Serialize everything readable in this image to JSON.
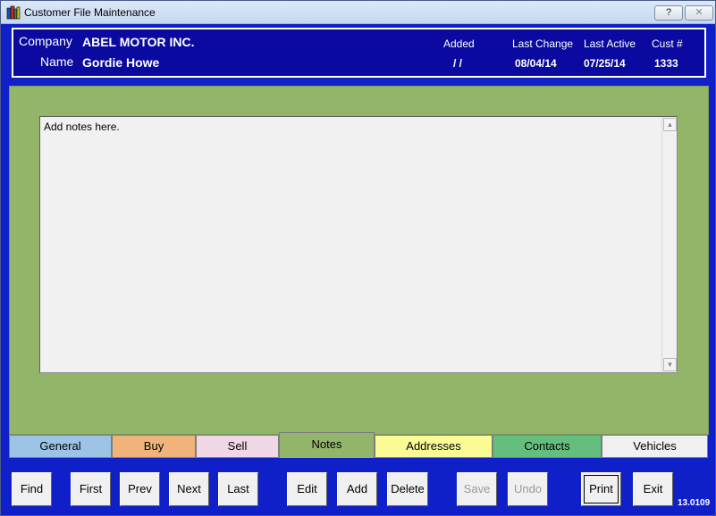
{
  "window": {
    "title": "Customer File Maintenance",
    "help_label": "?",
    "close_label": "✕"
  },
  "header": {
    "company_label": "Company",
    "company_value": "ABEL MOTOR INC.",
    "name_label": "Name",
    "name_value": "Gordie Howe",
    "added_label": "Added",
    "added_value": "/  /",
    "last_change_label": "Last Change",
    "last_change_value": "08/04/14",
    "last_active_label": "Last Active",
    "last_active_value": "07/25/14",
    "cust_label": "Cust #",
    "cust_value": "1333"
  },
  "notes": {
    "text": "Add notes here."
  },
  "tabs": [
    {
      "label": "General",
      "color": "#9dc3e6"
    },
    {
      "label": "Buy",
      "color": "#f0b47a"
    },
    {
      "label": "Sell",
      "color": "#f0d7e6"
    },
    {
      "label": "Notes",
      "color": "#92b56a"
    },
    {
      "label": "Addresses",
      "color": "#fbfb96"
    },
    {
      "label": "Contacts",
      "color": "#64bf7f"
    },
    {
      "label": "Vehicles",
      "color": "#f0f0f0"
    }
  ],
  "buttons": {
    "find": "Find",
    "first": "First",
    "prev": "Prev",
    "next": "Next",
    "last": "Last",
    "edit": "Edit",
    "add": "Add",
    "delete": "Delete",
    "save": "Save",
    "undo": "Undo",
    "print": "Print",
    "exit": "Exit"
  },
  "version": "13.0109"
}
